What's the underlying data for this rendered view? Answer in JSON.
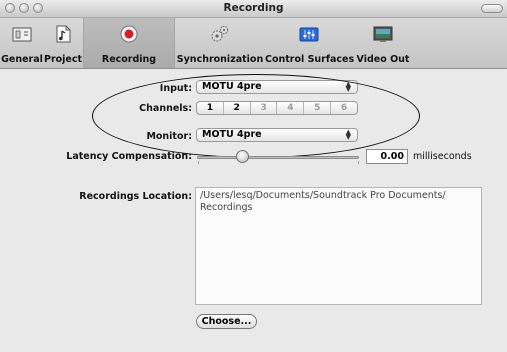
{
  "window": {
    "title": "Recording"
  },
  "toolbar": {
    "items": [
      {
        "label": "General",
        "icon": "general-icon"
      },
      {
        "label": "Project",
        "icon": "project-icon"
      },
      {
        "label": "Recording",
        "icon": "record-icon",
        "selected": true
      },
      {
        "label": "Synchronization",
        "icon": "sync-gears-icon"
      },
      {
        "label": "Control Surfaces",
        "icon": "control-surfaces-icon"
      },
      {
        "label": "Video Out",
        "icon": "video-out-icon"
      }
    ]
  },
  "recording": {
    "input_label": "Input:",
    "input_value": "MOTU 4pre",
    "channels_label": "Channels:",
    "channels": [
      "1",
      "2",
      "3",
      "4",
      "5",
      "6"
    ],
    "enabled_channels": 2,
    "monitor_label": "Monitor:",
    "monitor_value": "MOTU 4pre",
    "latency_label": "Latency Compensation:",
    "latency_value": "0.00",
    "latency_fraction": 0.28,
    "latency_unit": "milliseconds",
    "location_label": "Recordings Location:",
    "location_value": "/Users/lesq/Documents/Soundtrack Pro Documents/\nRecordings",
    "choose_button": "Choose..."
  },
  "colors": {
    "window_bg": "#e9e9e9",
    "record_red": "#d2202a",
    "accent_blue": "#1f5fd1"
  }
}
